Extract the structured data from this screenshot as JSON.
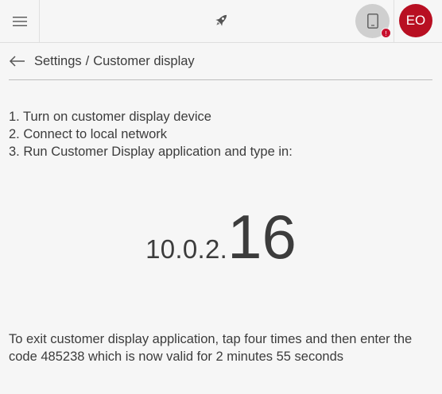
{
  "header": {
    "menu_icon": "hamburger-icon",
    "logo_icon": "rocket-icon",
    "device_icon": "tablet-icon",
    "device_badge": "!",
    "avatar_initials": "EO",
    "accent_color": "#b80f22"
  },
  "breadcrumb": {
    "back_icon": "arrow-left-icon",
    "parent": "Settings",
    "separator": "/",
    "current": "Customer display"
  },
  "steps": [
    "1. Turn on customer display device",
    "2. Connect to local network",
    "3. Run Customer Display application and type in:"
  ],
  "ip": {
    "prefix": "10.0.2.",
    "last": "16"
  },
  "exit_note": "To exit customer display application, tap four times and then enter the code 485238 which is now valid for 2 minutes 55 seconds"
}
